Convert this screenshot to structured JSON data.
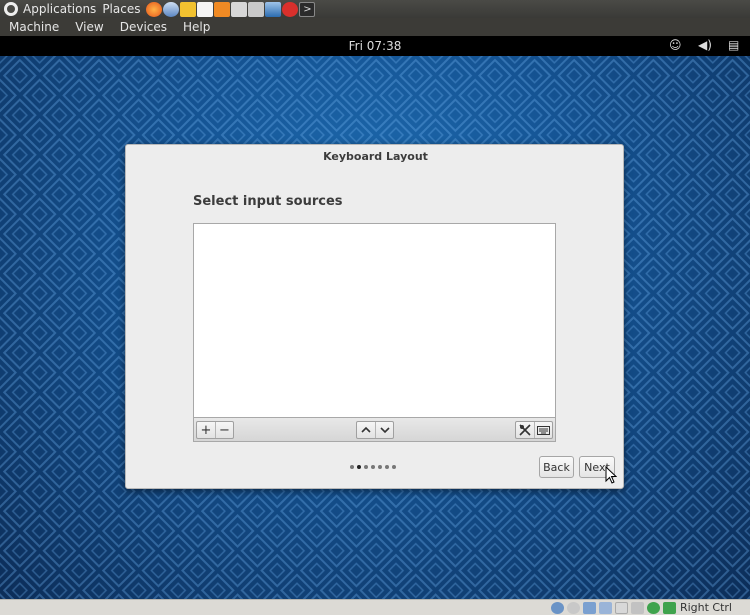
{
  "host_panel": {
    "applications_label": "Applications",
    "places_label": "Places",
    "launchers": [
      "firefox-icon",
      "thunderbird-icon",
      "vpn-icon",
      "text-editor-icon",
      "folder-icon",
      "remote-desktop-icon",
      "screenshot-icon",
      "virtualbox-icon",
      "bug-icon",
      "terminal-icon"
    ]
  },
  "vbox_menu": {
    "items": [
      "Machine",
      "View",
      "Devices",
      "Help"
    ]
  },
  "guest_topbar": {
    "clock": "Fri 07:38",
    "icons": [
      "accessibility-icon",
      "volume-icon",
      "clipboard-icon"
    ]
  },
  "dialog": {
    "title": "Keyboard Layout",
    "heading": "Select input sources",
    "toolbar": {
      "add_symbol": "+",
      "remove_symbol": "−",
      "up_symbol": "⌃",
      "down_symbol": "⌄"
    },
    "page_count": 7,
    "current_page": 2,
    "back_label": "Back",
    "next_label": "Next"
  },
  "status_bar": {
    "host_key": "Right Ctrl"
  },
  "colors": {
    "desktop": "#155494",
    "dialog_bg": "#ededed",
    "panel": "#3c3b37"
  }
}
